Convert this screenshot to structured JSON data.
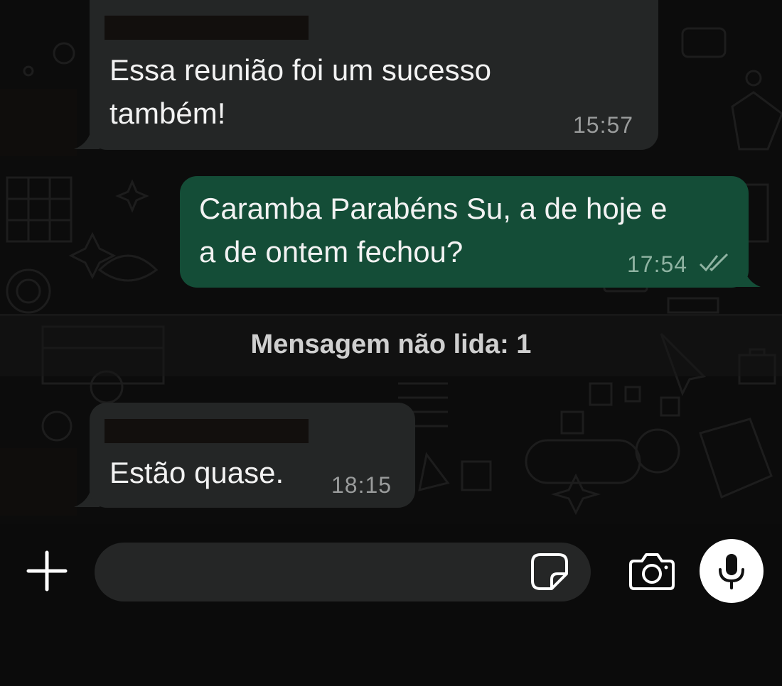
{
  "messages": [
    {
      "direction": "incoming",
      "text": "Essa reunião foi um sucesso\ntambém!",
      "time": "15:57"
    },
    {
      "direction": "outgoing",
      "text": "Caramba Parabéns Su, a de hoje e\na de ontem fechou?",
      "time": "17:54",
      "status": "read-double-check-icon"
    },
    {
      "direction": "incoming",
      "text": "Estão quase.",
      "time": "18:15"
    }
  ],
  "unread_divider": {
    "label": "Mensagem não lida: 1"
  },
  "composer": {
    "input_value": "",
    "icons": {
      "attach": "plus-icon",
      "sticker": "sticker-icon",
      "camera": "camera-icon",
      "mic": "microphone-icon"
    }
  },
  "colors": {
    "incoming_bubble": "#242626",
    "outgoing_bubble": "#144d37",
    "background": "#0c0c0c",
    "mic_button": "#ffffff"
  }
}
